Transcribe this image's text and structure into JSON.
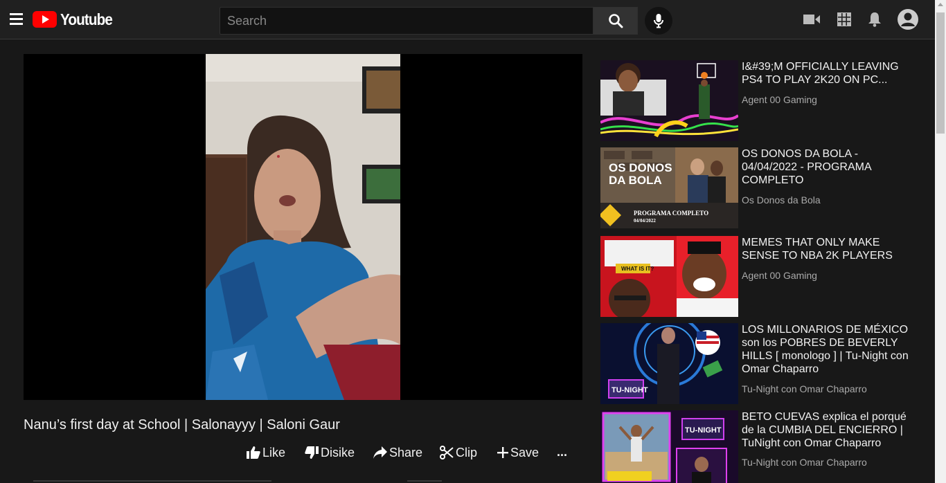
{
  "header": {
    "logo_text": "Youtube",
    "search_placeholder": "Search",
    "icons": [
      "menu-icon",
      "search-icon",
      "mic-icon",
      "create-video-icon",
      "apps-grid-icon",
      "notifications-bell-icon",
      "account-avatar-icon"
    ]
  },
  "video": {
    "title": "Nanu’s first day at School | Salonayyy | Saloni Gaur",
    "actions": {
      "like": "Like",
      "dislike": "Disike",
      "share": "Share",
      "clip": "Clip",
      "save": "Save",
      "more": "..."
    }
  },
  "recommendations": [
    {
      "title": "I&#39;M OFFICIALLY LEAVING PS4 TO PLAY 2K20 ON PC...",
      "channel": "Agent 00 Gaming"
    },
    {
      "title": "OS DONOS DA BOLA - 04/04/2022 - PROGRAMA COMPLETO",
      "channel": "Os Donos da Bola",
      "thumb_text": [
        "OS DONOS",
        "DA BOLA",
        "PROGRAMA COMPLETO",
        "04/04/2022"
      ]
    },
    {
      "title": "MEMES THAT ONLY MAKE SENSE TO NBA 2K PLAYERS",
      "channel": "Agent 00 Gaming",
      "thumb_text": [
        "WHAT IS IT?"
      ]
    },
    {
      "title": "LOS MILLONARIOS DE MÉXICO son los POBRES DE BEVERLY HILLS [ monologo ] | Tu-Night con Omar Chaparro",
      "channel": "Tu-Night con Omar Chaparro",
      "thumb_text": [
        "TU-NIGHT"
      ]
    },
    {
      "title": "BETO CUEVAS explica el porqué de la CUMBIA DEL ENCIERRO | TuNight con Omar Chaparro",
      "channel": "Tu-Night con Omar Chaparro",
      "thumb_text": [
        "TU-NIGHT"
      ]
    }
  ],
  "colors": {
    "background": "#181818",
    "header": "#202020",
    "brand_red": "#ff0000",
    "secondary_text": "#aaaaaa"
  }
}
